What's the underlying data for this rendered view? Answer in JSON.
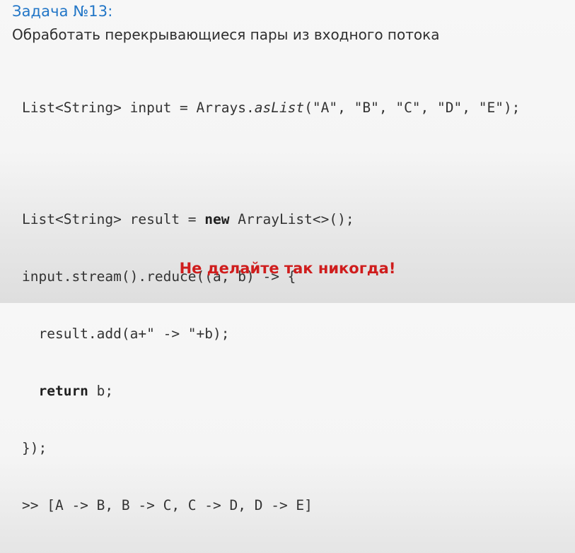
{
  "slide": {
    "title": "Задача №13:",
    "description": "Обработать перекрывающиеся пары из входного потока",
    "code": {
      "line1_a": "List<String> input = Arrays.",
      "line1_b": "asList",
      "line1_c": "(\"A\", \"B\", \"C\", \"D\", \"E\");",
      "line2_a": "List<String> result = ",
      "line2_kw": "new",
      "line2_b": " ArrayList<>();",
      "line3": "input.stream().reduce((a, b) -> {",
      "line4": "  result.add(a+\" -> \"+b);",
      "line5_indent": "  ",
      "line5_kw": "return",
      "line5_b": " b;",
      "line6": "});",
      "output": ">> [A -> B, B -> C, C -> D, D -> E]"
    },
    "warning": "Не делайте так никогда!"
  }
}
